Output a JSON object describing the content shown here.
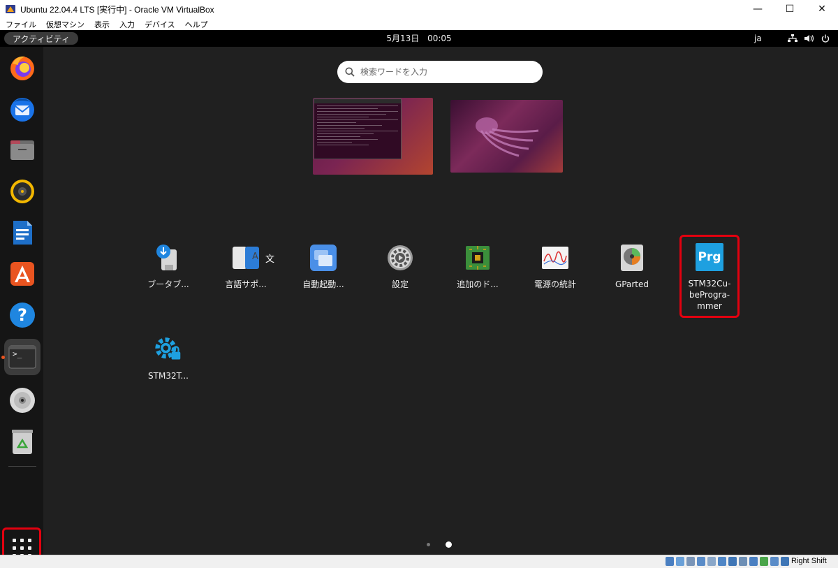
{
  "window": {
    "title": "Ubuntu 22.04.4 LTS [実行中] - Oracle VM VirtualBox",
    "controls": {
      "minimize": "—",
      "maximize": "☐",
      "close": "✕"
    }
  },
  "menubar": [
    "ファイル",
    "仮想マシン",
    "表示",
    "入力",
    "デバイス",
    "ヘルプ"
  ],
  "topbar": {
    "activities": "アクティビティ",
    "date": "5月13日",
    "time": "00:05",
    "input_method": "ja",
    "tray_icons": [
      "network-icon",
      "volume-icon",
      "power-icon"
    ]
  },
  "dock": {
    "items": [
      {
        "name": "firefox",
        "icon": "firefox-icon"
      },
      {
        "name": "thunderbird",
        "icon": "thunderbird-icon"
      },
      {
        "name": "files",
        "icon": "files-icon"
      },
      {
        "name": "rhythmbox",
        "icon": "rhythmbox-icon"
      },
      {
        "name": "libreoffice-writer",
        "icon": "writer-icon"
      },
      {
        "name": "app-center",
        "icon": "app-center-icon"
      },
      {
        "name": "help",
        "icon": "help-icon"
      },
      {
        "name": "terminal",
        "icon": "terminal-icon",
        "running": true
      },
      {
        "name": "dvd",
        "icon": "disc-icon"
      },
      {
        "name": "trash",
        "icon": "trash-icon"
      }
    ],
    "terminal_prompt": ">_",
    "show_apps": "show-apps-icon"
  },
  "search": {
    "placeholder": "検索ワードを入力"
  },
  "apps": [
    {
      "label": "ブータブ...",
      "icon": "usb-creator-icon"
    },
    {
      "label": "言語サポ...",
      "icon": "language-support-icon",
      "glyph_left": "A",
      "glyph_right": "文"
    },
    {
      "label": "自動起動...",
      "icon": "startup-apps-icon"
    },
    {
      "label": "設定",
      "icon": "settings-icon"
    },
    {
      "label": "追加のド...",
      "icon": "additional-drivers-icon"
    },
    {
      "label": "電源の統計",
      "icon": "power-statistics-icon"
    },
    {
      "label": "GParted",
      "icon": "gparted-icon"
    },
    {
      "label": "STM32Cu-beProgra-mmer",
      "icon": "stm32cubeprogrammer-icon",
      "glyph": "Prg",
      "highlighted": true
    },
    {
      "label": "STM32T...",
      "icon": "stm32-trusted-package-icon"
    }
  ],
  "pager": {
    "pages": 2,
    "current": 2
  },
  "statusbar": {
    "host_key": "Right Shift",
    "colors": {
      "highlight": "#e3000f",
      "ubuntu_orange": "#e95420"
    }
  }
}
